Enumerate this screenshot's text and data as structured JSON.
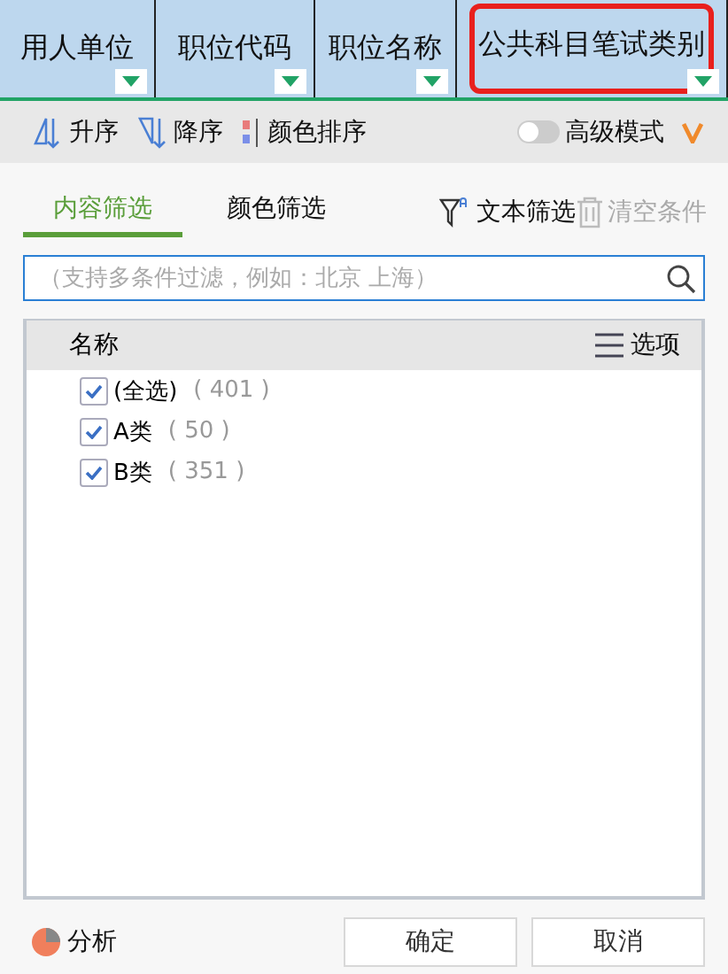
{
  "columns": [
    {
      "label": "用人单位",
      "highlighted": false
    },
    {
      "label": "职位代码",
      "highlighted": false
    },
    {
      "label": "职位名称",
      "highlighted": false
    },
    {
      "label": "公共科目笔试类别",
      "highlighted": true
    }
  ],
  "toolbar": {
    "sort_asc": "升序",
    "sort_desc": "降序",
    "color_sort": "颜色排序",
    "advanced": {
      "label": "高级模式",
      "on": false
    }
  },
  "tabs": [
    {
      "label": "内容筛选",
      "selected": true
    },
    {
      "label": "颜色筛选",
      "selected": false
    }
  ],
  "text_filter": "文本筛选",
  "clear": {
    "label": "清空条件",
    "disabled": true
  },
  "search": {
    "placeholder": "（支持多条件过滤，例如：北京 上海）"
  },
  "list": {
    "header": "名称",
    "options": "选项",
    "items": [
      {
        "label": "(全选)",
        "count": "( 401 )",
        "checked": true
      },
      {
        "label": "A类",
        "count": "( 50 )",
        "checked": true
      },
      {
        "label": "B类",
        "count": "( 351 )",
        "checked": true
      }
    ]
  },
  "analyze": "分析",
  "buttons": [
    "确定",
    "取消"
  ]
}
